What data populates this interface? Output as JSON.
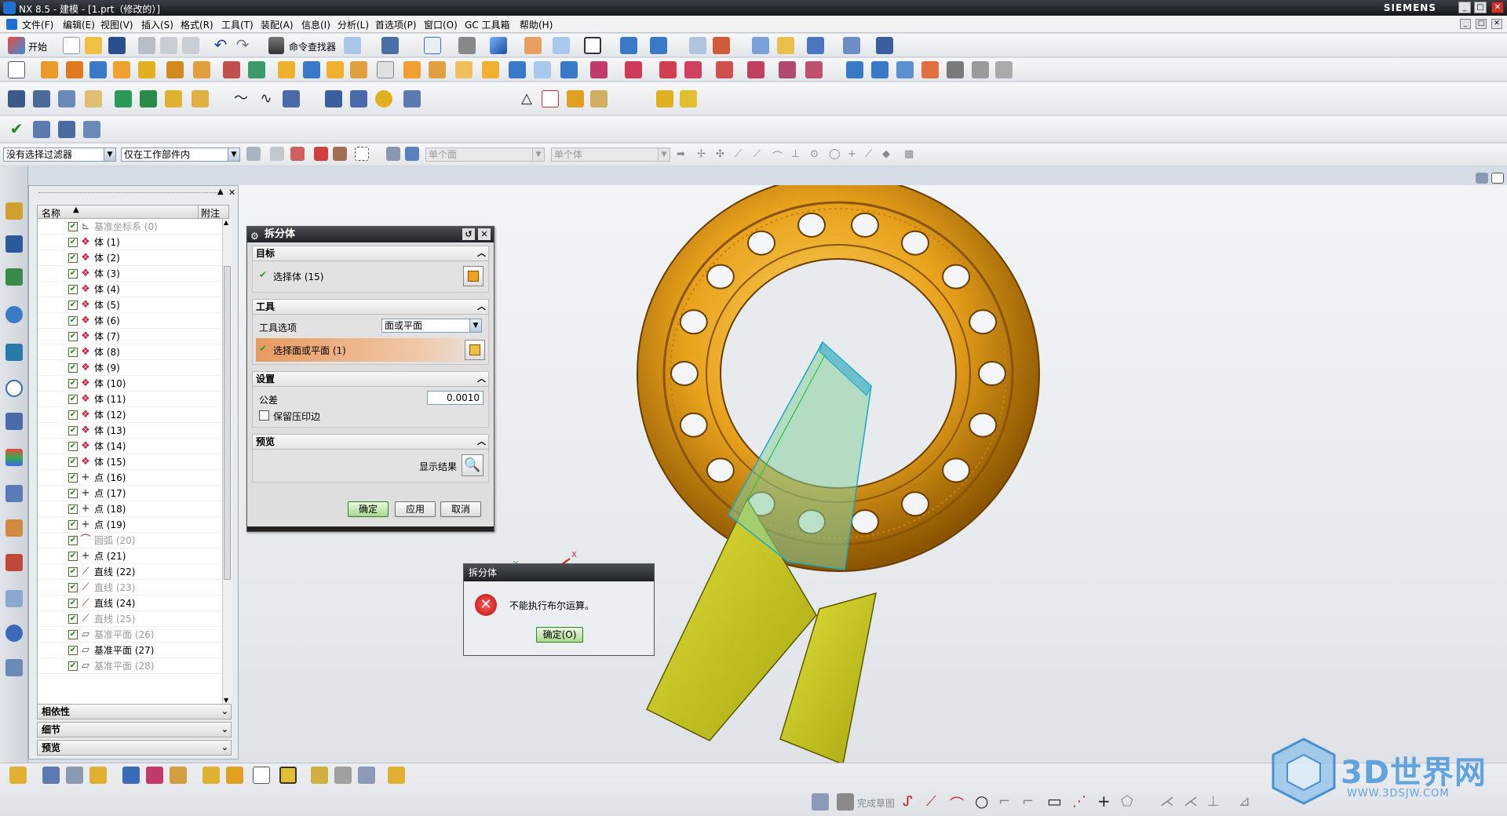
{
  "window": {
    "title": "NX 8.5 - 建模 - [1.prt（修改的）]",
    "brand": "SIEMENS",
    "min": "_",
    "max": "□",
    "close": "✕"
  },
  "menu": [
    "文件(F)",
    "编辑(E)",
    "视图(V)",
    "插入(S)",
    "格式(R)",
    "工具(T)",
    "装配(A)",
    "信息(I)",
    "分析(L)",
    "首选项(P)",
    "窗口(O)",
    "GC 工具箱",
    "帮助(H)"
  ],
  "toolbar": {
    "start_label": "开始",
    "command_finder": "命令查找器"
  },
  "selection_bar": {
    "filter_value": "没有选择过滤器",
    "scope_value": "仅在工作部件内",
    "face_rule": "单个面",
    "body_rule": "单个体"
  },
  "navigator": {
    "col_name": "名称",
    "col_note": "附注",
    "items": [
      {
        "label": "基准坐标系 (0)",
        "icon": "csys-icon",
        "dim": true
      },
      {
        "label": "体 (1)",
        "icon": "body-icon",
        "dim": false
      },
      {
        "label": "体 (2)",
        "icon": "body-icon",
        "dim": false
      },
      {
        "label": "体 (3)",
        "icon": "body-icon",
        "dim": false
      },
      {
        "label": "体 (4)",
        "icon": "body-icon",
        "dim": false
      },
      {
        "label": "体 (5)",
        "icon": "body-icon",
        "dim": false
      },
      {
        "label": "体 (6)",
        "icon": "body-icon",
        "dim": false
      },
      {
        "label": "体 (7)",
        "icon": "body-icon",
        "dim": false
      },
      {
        "label": "体 (8)",
        "icon": "body-icon",
        "dim": false
      },
      {
        "label": "体 (9)",
        "icon": "body-icon",
        "dim": false
      },
      {
        "label": "体 (10)",
        "icon": "body-icon",
        "dim": false
      },
      {
        "label": "体 (11)",
        "icon": "body-icon",
        "dim": false
      },
      {
        "label": "体 (12)",
        "icon": "body-icon",
        "dim": false
      },
      {
        "label": "体 (13)",
        "icon": "body-icon",
        "dim": false
      },
      {
        "label": "体 (14)",
        "icon": "body-icon",
        "dim": false
      },
      {
        "label": "体 (15)",
        "icon": "body-icon",
        "dim": false
      },
      {
        "label": "点 (16)",
        "icon": "point-icon",
        "dim": false
      },
      {
        "label": "点 (17)",
        "icon": "point-icon",
        "dim": false
      },
      {
        "label": "点 (18)",
        "icon": "point-icon",
        "dim": false
      },
      {
        "label": "点 (19)",
        "icon": "point-icon",
        "dim": false
      },
      {
        "label": "圆弧 (20)",
        "icon": "arc-icon",
        "dim": true
      },
      {
        "label": "点 (21)",
        "icon": "point-icon",
        "dim": false
      },
      {
        "label": "直线 (22)",
        "icon": "line-icon",
        "dim": false
      },
      {
        "label": "直线 (23)",
        "icon": "line-icon",
        "dim": true
      },
      {
        "label": "直线 (24)",
        "icon": "line-icon",
        "dim": false
      },
      {
        "label": "直线 (25)",
        "icon": "line-icon",
        "dim": true
      },
      {
        "label": "基准平面 (26)",
        "icon": "datum-plane-icon",
        "dim": true
      },
      {
        "label": "基准平面 (27)",
        "icon": "datum-plane-icon",
        "dim": false
      },
      {
        "label": "基准平面 (28)",
        "icon": "datum-plane-icon",
        "dim": true
      }
    ],
    "sections": [
      "相依性",
      "细节",
      "预览"
    ]
  },
  "split_dialog": {
    "title": "拆分体",
    "target_header": "目标",
    "select_body": "选择体 (15)",
    "tool_header": "工具",
    "tool_option_label": "工具选项",
    "tool_option_value": "面或平面",
    "select_face": "选择面或平面 (1)",
    "settings_header": "设置",
    "tolerance_label": "公差",
    "tolerance_value": "0.0010",
    "keep_imprint": "保留压印边",
    "preview_header": "预览",
    "show_result": "显示结果",
    "ok": "确定",
    "apply": "应用",
    "cancel": "取消"
  },
  "error_dialog": {
    "title": "拆分体",
    "message": "不能执行布尔运算。",
    "ok": "确定(O)"
  },
  "bottom_toolbar": {
    "finish_sketch": "完成草图"
  },
  "watermark": {
    "brand": "3D世界网",
    "url": "WWW.3DSJW.COM"
  },
  "colors": {
    "part_orange": "#e8a21c",
    "sheet_yellow": "#c9c81a",
    "ok_green": "#2f9e2f",
    "error_red": "#d02020"
  }
}
